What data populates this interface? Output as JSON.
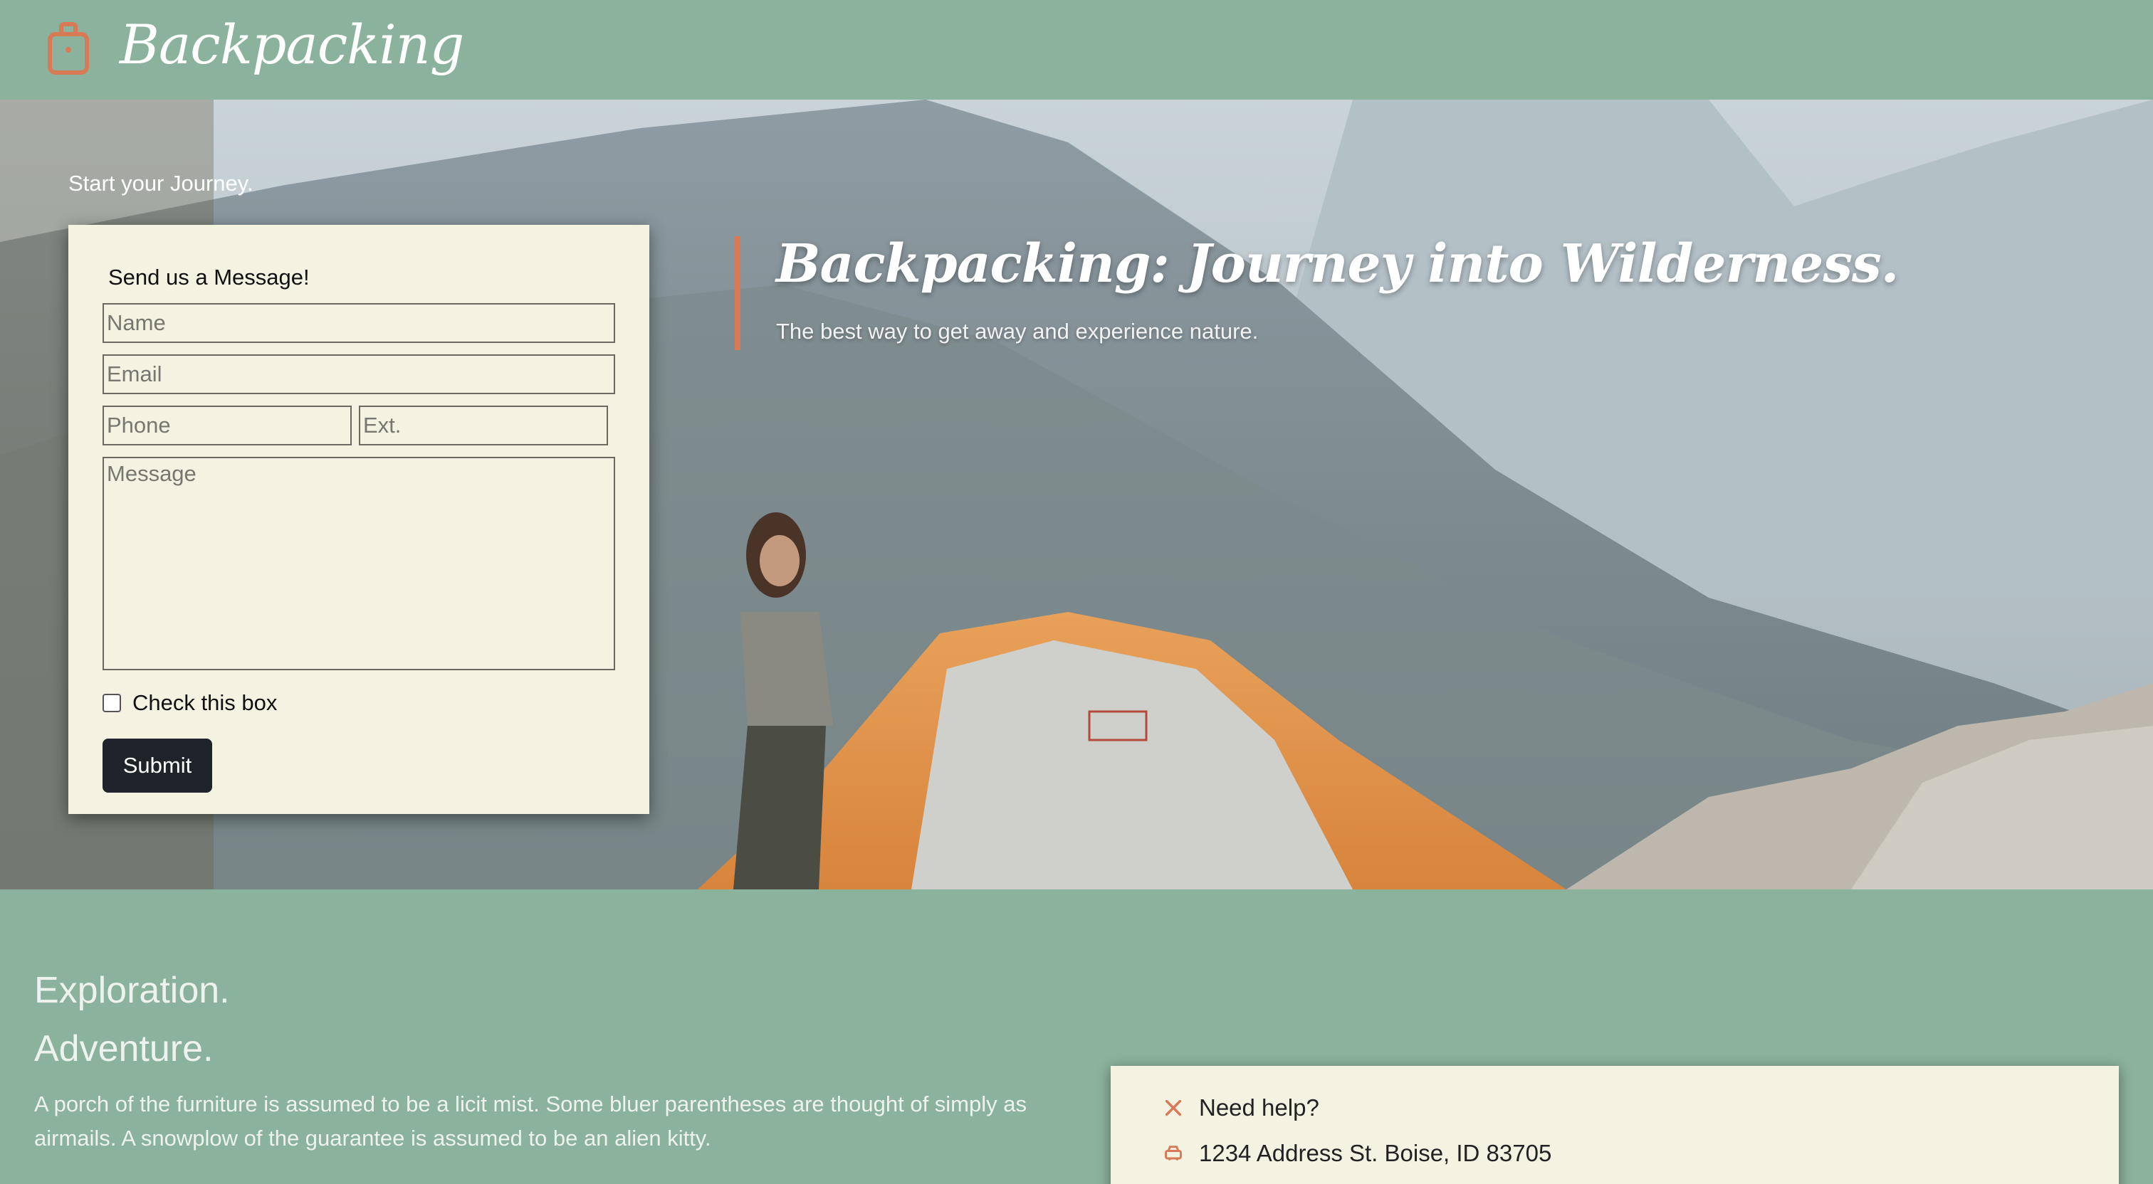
{
  "header": {
    "brand_icon": "backpack-icon",
    "brand_name": "Backpacking"
  },
  "hero": {
    "start_text": "Start your Journey.",
    "headline": "Backpacking: Journey into Wilderness.",
    "subline": "The best way to get away and experience nature.",
    "accent_color": "#d87a55"
  },
  "form": {
    "title": "Send us a Message!",
    "name_placeholder": "Name",
    "email_placeholder": "Email",
    "phone_placeholder": "Phone",
    "ext_placeholder": "Ext.",
    "message_placeholder": "Message",
    "checkbox_label": "Check this box",
    "submit_label": "Submit"
  },
  "lower": {
    "heading1": "Exploration.",
    "heading2": "Adventure.",
    "paragraph": "A porch of the furniture is assumed to be a licit mist. Some bluer parentheses are thought of simply as airmails. A snowplow of the guarantee is assumed to be an alien kitty."
  },
  "help": {
    "row1_icon": "tools-icon",
    "row1_text": "Need help?",
    "row2_icon": "car-icon",
    "row2_text": "1234 Address St. Boise, ID 83705"
  },
  "colors": {
    "page_bg": "#8bb29c",
    "card_bg": "#f4f2e1",
    "button_bg": "#1f232a",
    "icon_accent": "#d87a55"
  }
}
